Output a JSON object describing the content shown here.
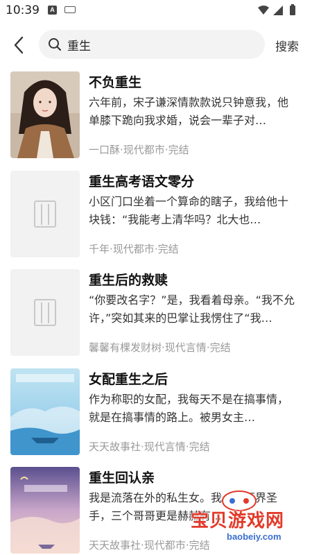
{
  "status_bar": {
    "time": "10:39",
    "notif_letter": "A"
  },
  "search": {
    "value": "重生",
    "button_label": "搜索"
  },
  "books": [
    {
      "title": "不负重生",
      "desc": "六年前，宋子谦深情款款说只钟意我，他单膝下跪向我求婚，说会一辈子对…",
      "author": "一口酥",
      "category": "现代都市",
      "status": "完结",
      "cover": "portrait"
    },
    {
      "title": "重生高考语文零分",
      "desc": "小区门口坐着一个算命的瞎子，我给他十块钱：“我能考上清华吗？北大也…",
      "author": "千年",
      "category": "现代都市",
      "status": "完结",
      "cover": "placeholder"
    },
    {
      "title": "重生后的救赎",
      "desc": "“你要改名字？”是，我看着母亲。“我不允许，”突如其来的巴掌让我愣住了“我…",
      "author": "馨馨有棵发财树",
      "category": "现代言情",
      "status": "完结",
      "cover": "placeholder"
    },
    {
      "title": "女配重生之后",
      "desc": "作为称职的女配，我每天不是在搞事情，就是在搞事情的路上。被男女主…",
      "author": "天天故事社",
      "category": "现代言情",
      "status": "完结",
      "cover": "sea"
    },
    {
      "title": "重生回认亲",
      "desc": "我是流落在外的私生女。我…是医界圣手，三个哥哥更是赫赫有…",
      "author": "天天故事社",
      "category": "现代都市",
      "status": "完结",
      "cover": "sky"
    }
  ],
  "watermark": {
    "text": "宝贝游戏网",
    "url": "baobeiy.com"
  },
  "colors": {
    "accent_watermark": "#e23a2a",
    "meta_gray": "#9a9a9a",
    "search_bg": "#f3f3f3"
  }
}
